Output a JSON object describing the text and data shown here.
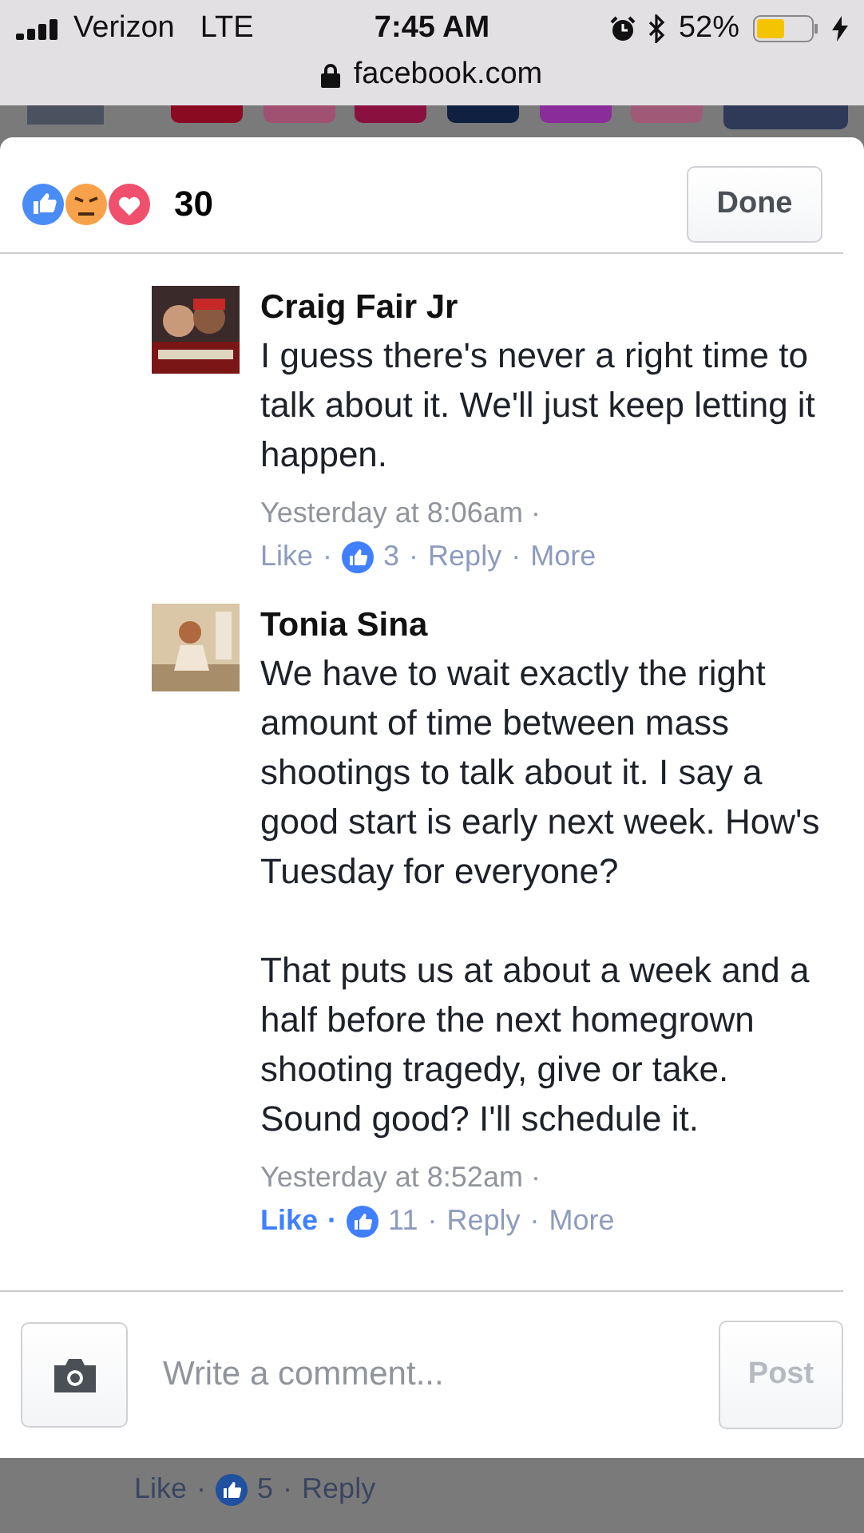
{
  "status_bar": {
    "carrier": "Verizon",
    "network": "LTE",
    "time": "7:45 AM",
    "battery": "52%"
  },
  "address_bar": {
    "url": "facebook.com"
  },
  "reactions": {
    "count": "30"
  },
  "done_button": "Done",
  "comments": [
    {
      "author": "Craig Fair Jr",
      "text": "I guess there's never a right time to talk about it. We'll just keep letting it happen.",
      "time": "Yesterday at 8:06am ·",
      "like": "Like",
      "liked": false,
      "likes": "3",
      "reply": "Reply",
      "more": "More",
      "separator": "·"
    },
    {
      "author": "Tonia Sina",
      "text": "We have to wait exactly the right amount of time between mass shootings to talk about it. I say a good start is early next week. How's Tuesday for everyone?\n\nThat puts us at about a week and a half before the next homegrown shooting tragedy, give or take. Sound good? I'll schedule it.",
      "time": "Yesterday at 8:52am ·",
      "like": "Like",
      "liked": true,
      "likes": "11",
      "reply": "Reply",
      "more": "More",
      "separator": "·"
    }
  ],
  "composer": {
    "placeholder": "Write a comment...",
    "post": "Post"
  },
  "background_comment": {
    "like": "Like",
    "likes": "5",
    "reply": "Reply",
    "separator": "·"
  }
}
